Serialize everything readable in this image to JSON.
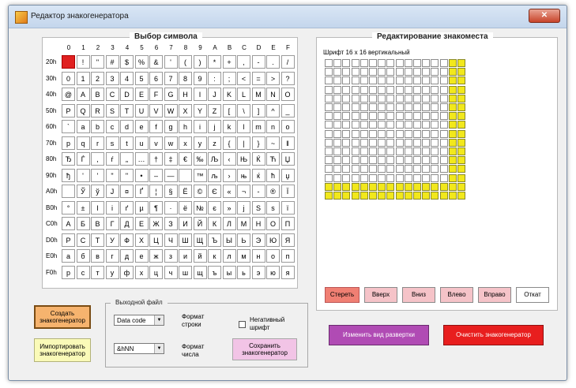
{
  "window": {
    "title": "Редактор знакогенератора",
    "close_label": "✕"
  },
  "left_panel": {
    "title": "Выбор символа"
  },
  "hex_columns": [
    "0",
    "1",
    "2",
    "3",
    "4",
    "5",
    "6",
    "7",
    "8",
    "9",
    "A",
    "B",
    "C",
    "D",
    "E",
    "F"
  ],
  "rows": [
    {
      "label": "20h",
      "chars": [
        "",
        " !",
        "\"",
        "#",
        "$",
        "%",
        "&",
        "'",
        "(",
        ")",
        "*",
        "+",
        ",",
        "-",
        ".",
        "/"
      ]
    },
    {
      "label": "30h",
      "chars": [
        "0",
        "1",
        "2",
        "3",
        "4",
        "5",
        "6",
        "7",
        "8",
        "9",
        ":",
        ";",
        "<",
        "=",
        ">",
        "?"
      ]
    },
    {
      "label": "40h",
      "chars": [
        "@",
        "A",
        "B",
        "C",
        "D",
        "E",
        "F",
        "G",
        "H",
        "I",
        "J",
        "K",
        "L",
        "M",
        "N",
        "O"
      ]
    },
    {
      "label": "50h",
      "chars": [
        "P",
        "Q",
        "R",
        "S",
        "T",
        "U",
        "V",
        "W",
        "X",
        "Y",
        "Z",
        "[",
        "\\",
        "]",
        "^",
        "_"
      ]
    },
    {
      "label": "60h",
      "chars": [
        "`",
        "a",
        "b",
        "c",
        "d",
        "e",
        "f",
        "g",
        "h",
        "i",
        "j",
        "k",
        "l",
        "m",
        "n",
        "o"
      ]
    },
    {
      "label": "70h",
      "chars": [
        "p",
        "q",
        "r",
        "s",
        "t",
        "u",
        "v",
        "w",
        "x",
        "y",
        "z",
        "{",
        "|",
        "}",
        "~",
        "‖"
      ]
    },
    {
      "label": "80h",
      "chars": [
        "Ђ",
        "Ѓ",
        ",",
        "ѓ",
        "„",
        "…",
        "†",
        "‡",
        "€",
        "‰",
        "Љ",
        "‹",
        "Њ",
        "Ќ",
        "Ћ",
        "Џ"
      ]
    },
    {
      "label": "90h",
      "chars": [
        "ђ",
        "'",
        "'",
        "\"",
        "\"",
        "•",
        "–",
        "—",
        "",
        "™",
        "љ",
        "›",
        "њ",
        "ќ",
        "ћ",
        "џ"
      ]
    },
    {
      "label": "A0h",
      "chars": [
        "",
        "Ў",
        "ў",
        "Ј",
        "¤",
        "Ґ",
        "¦",
        "§",
        "Ё",
        "©",
        "Є",
        "«",
        "¬",
        "-",
        "®",
        "Ї"
      ]
    },
    {
      "label": "B0h",
      "chars": [
        "°",
        "±",
        "І",
        "і",
        "ґ",
        "µ",
        "¶",
        "·",
        "ё",
        "№",
        "є",
        "»",
        "ј",
        "Ѕ",
        "ѕ",
        "ї"
      ]
    },
    {
      "label": "C0h",
      "chars": [
        "А",
        "Б",
        "В",
        "Г",
        "Д",
        "Е",
        "Ж",
        "З",
        "И",
        "Й",
        "К",
        "Л",
        "М",
        "Н",
        "О",
        "П"
      ]
    },
    {
      "label": "D0h",
      "chars": [
        "Р",
        "С",
        "Т",
        "У",
        "Ф",
        "Х",
        "Ц",
        "Ч",
        "Ш",
        "Щ",
        "Ъ",
        "Ы",
        "Ь",
        "Э",
        "Ю",
        "Я"
      ]
    },
    {
      "label": "E0h",
      "chars": [
        "а",
        "б",
        "в",
        "г",
        "д",
        "е",
        "ж",
        "з",
        "и",
        "й",
        "к",
        "л",
        "м",
        "н",
        "о",
        "п"
      ]
    },
    {
      "label": "F0h",
      "chars": [
        "р",
        "с",
        "т",
        "у",
        "ф",
        "х",
        "ц",
        "ч",
        "ш",
        "щ",
        "ъ",
        "ы",
        "ь",
        "э",
        "ю",
        "я"
      ]
    }
  ],
  "right_panel": {
    "title": "Редактирование знакоместа",
    "font_label": "Шрифт 16 х 16 вертикальный"
  },
  "edit_buttons": {
    "erase": "Стереть",
    "up": "Вверх",
    "down": "Вниз",
    "left": "Влево",
    "right": "Вправо",
    "undo": "Откат"
  },
  "actions": {
    "create": "Создать знакогенератор",
    "import": "Импортировать знакогенератор",
    "change_scan": "Изменить вид развертки",
    "clear": "Очистить знакогенератор"
  },
  "output": {
    "title": "Выходной файл",
    "format_select": "Data code",
    "number_select": "&hNN",
    "row_format_label": "Формат строки",
    "number_format_label": "Формат числа",
    "negative_label": "Негативный шрифт",
    "negative_checked": false,
    "save_button": "Сохранить знакогенератор"
  },
  "colors": {
    "accent_red": "#e02020",
    "grid_on": "#f2e81c"
  }
}
